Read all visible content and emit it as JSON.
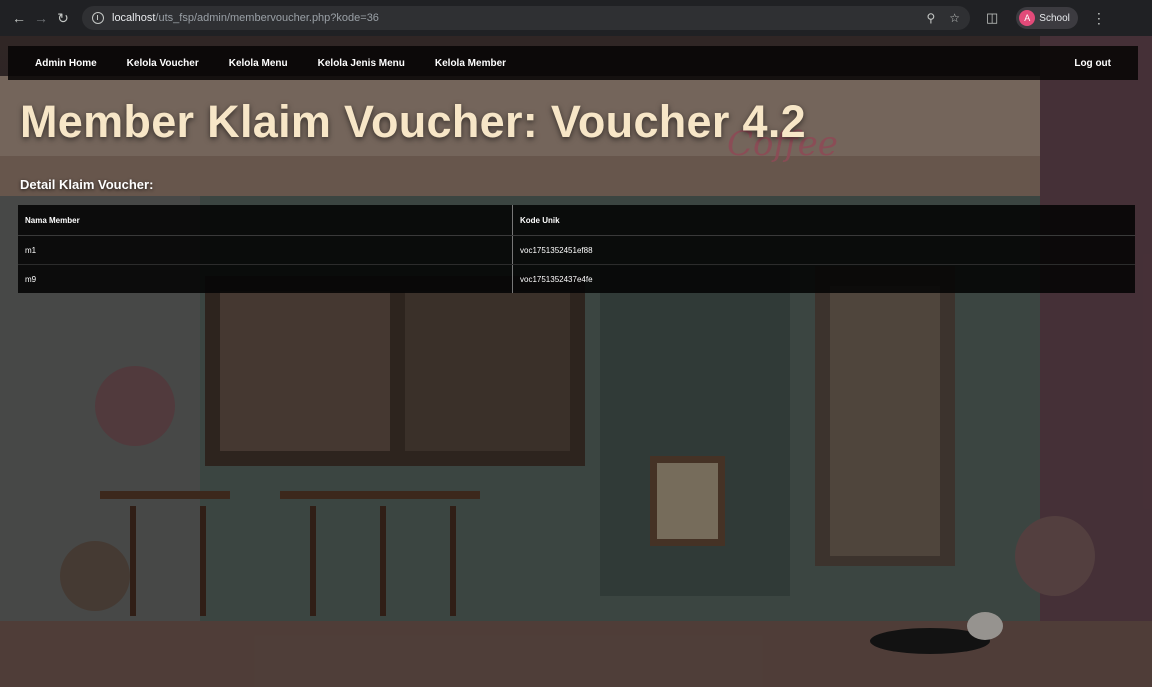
{
  "browser": {
    "url_host": "localhost",
    "url_path": "/uts_fsp/admin/membervoucher.php?kode=36",
    "profile_initial": "A",
    "profile_name": "School"
  },
  "navbar": {
    "items": [
      {
        "label": "Admin Home"
      },
      {
        "label": "Kelola Voucher"
      },
      {
        "label": "Kelola Menu"
      },
      {
        "label": "Kelola Jenis Menu"
      },
      {
        "label": "Kelola Member"
      }
    ],
    "logout": "Log out"
  },
  "page": {
    "title": "Member Klaim Voucher: Voucher 4.2",
    "subtitle": "Detail Klaim Voucher:",
    "background_sign": "Coffee"
  },
  "table": {
    "headers": [
      "Nama Member",
      "Kode Unik"
    ],
    "rows": [
      [
        "m1",
        "voc1751352451ef88"
      ],
      [
        "m9",
        "voc1751352437e4fe"
      ]
    ]
  }
}
